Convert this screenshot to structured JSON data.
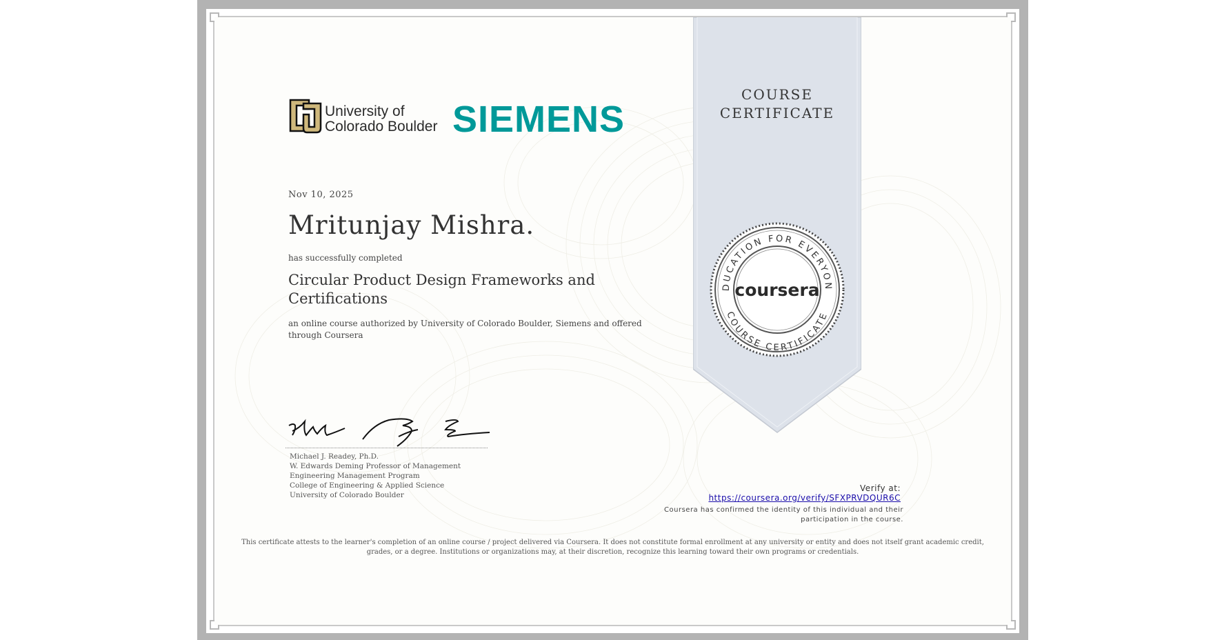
{
  "logos": {
    "university_name": "University of Colorado Boulder",
    "company_name": "SIEMENS",
    "company_color": "#009999",
    "university_gold": "#cfb87c"
  },
  "ribbon": {
    "title": "COURSE CERTIFICATE",
    "color": "#dde2ea"
  },
  "seal": {
    "top_text": "EDUCATION FOR EVERYONE",
    "bottom_text": "COURSE CERTIFICATE",
    "brand": "coursera"
  },
  "certificate": {
    "date": "Nov 10, 2025",
    "learner_name": "Mritunjay Mishra.",
    "completed_text": "has successfully completed",
    "course_title": "Circular Product Design Frameworks and Certifications",
    "authorized_text": "an online course authorized by University of Colorado Boulder, Siemens and offered through Coursera"
  },
  "signer": {
    "lines": [
      "Michael J. Readey, Ph.D.",
      "W. Edwards Deming Professor of Management",
      "Engineering Management Program",
      "College of Engineering & Applied Science",
      "University of Colorado Boulder"
    ]
  },
  "verification": {
    "label": "Verify at:",
    "url": "https://coursera.org/verify/SFXPRVDQUR6C",
    "confirmed_text": "Coursera has confirmed the identity of this individual and their participation in the course."
  },
  "disclaimer": "This certificate attests to the learner's completion of an online course / project delivered via Coursera. It does not constitute formal enrollment at any university or entity and does not itself grant academic credit, grades, or a degree. Institutions or organizations may, at their discretion, recognize this learning toward their own programs or credentials."
}
